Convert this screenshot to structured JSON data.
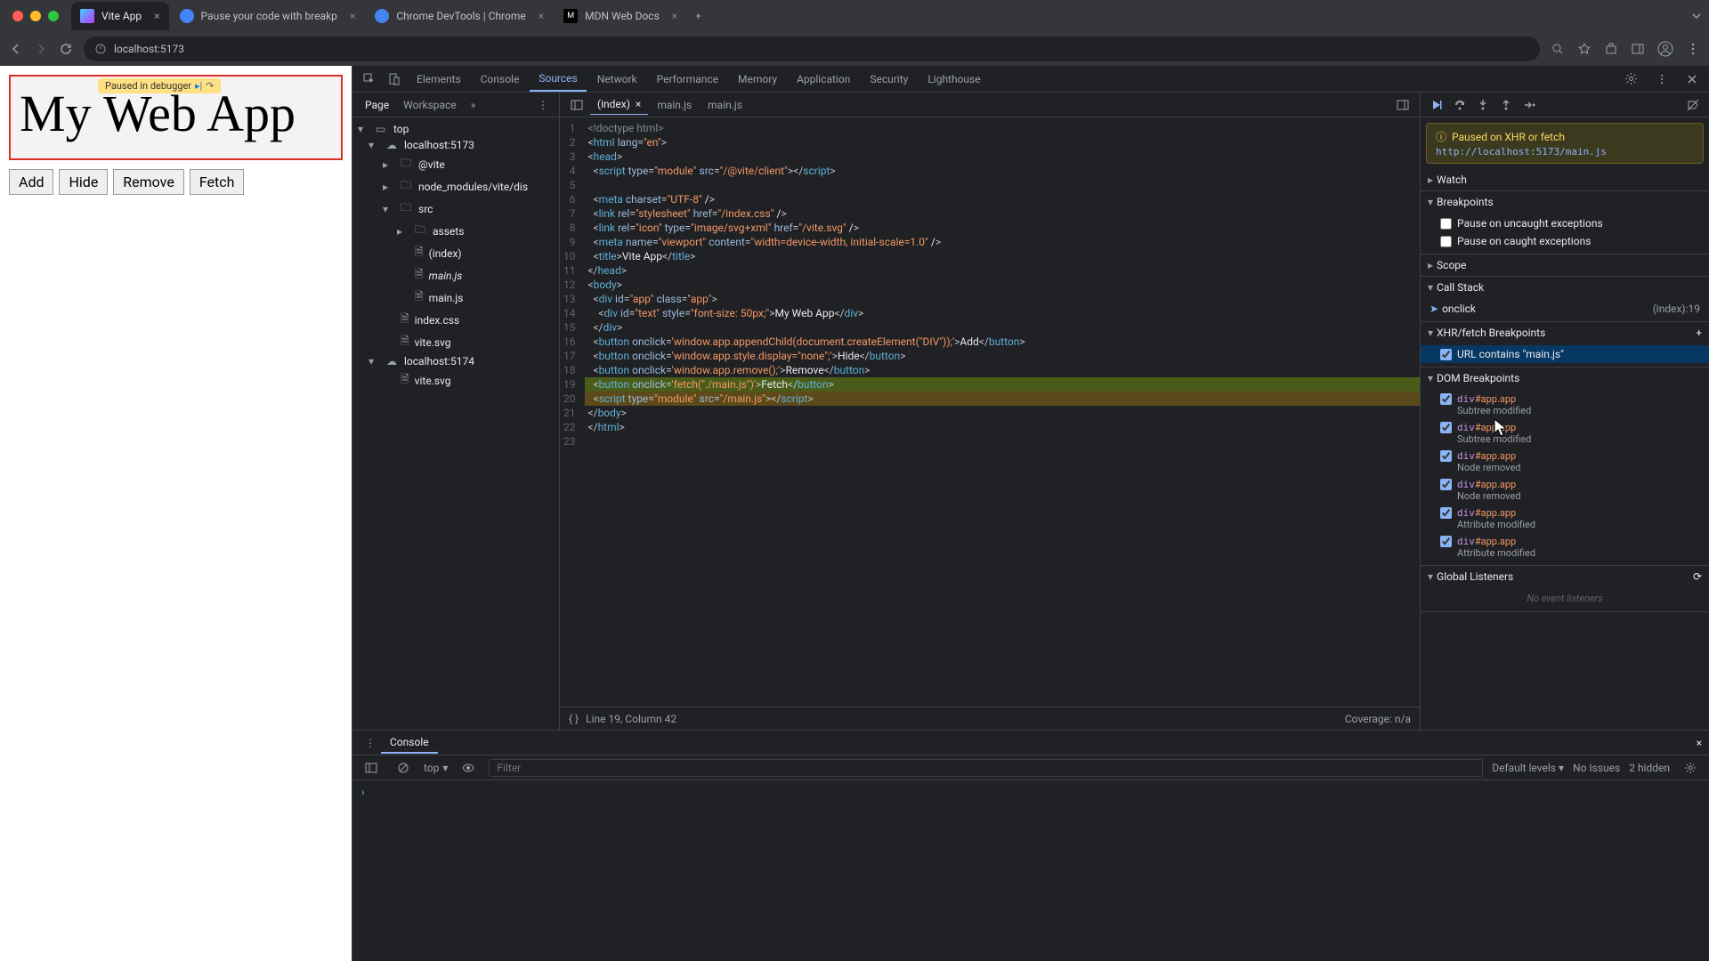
{
  "browser": {
    "tabs": [
      {
        "title": "Vite App",
        "active": true
      },
      {
        "title": "Pause your code with breakp",
        "active": false
      },
      {
        "title": "Chrome DevTools | Chrome",
        "active": false
      },
      {
        "title": "MDN Web Docs",
        "active": false
      }
    ],
    "url": "localhost:5173"
  },
  "preview": {
    "paused_label": "Paused in debugger",
    "title": "My Web App",
    "buttons": [
      "Add",
      "Hide",
      "Remove",
      "Fetch"
    ]
  },
  "devtools": {
    "panels": [
      "Elements",
      "Console",
      "Sources",
      "Network",
      "Performance",
      "Memory",
      "Application",
      "Security",
      "Lighthouse"
    ],
    "active_panel": "Sources",
    "sidebar_tabs": [
      "Page",
      "Workspace"
    ],
    "file_tree": {
      "top": "top",
      "host1": "localhost:5173",
      "vite": "@vite",
      "node_modules": "node_modules/vite/dis",
      "src": "src",
      "assets": "assets",
      "index": "(index)",
      "mainjs_italic": "main.js",
      "mainjs": "main.js",
      "indexcss": "index.css",
      "vitesvg": "vite.svg",
      "host2": "localhost:5174",
      "vitesvg2": "vite.svg"
    },
    "editor_tabs": [
      {
        "name": "(index)",
        "active": true
      },
      {
        "name": "main.js",
        "active": false
      },
      {
        "name": "main.js",
        "active": false
      }
    ],
    "code_lines": [
      "<!doctype html>",
      "<html lang=\"en\">",
      "<head>",
      "  <script type=\"module\" src=\"/@vite/client\"></scr_ipt>",
      "",
      "  <meta charset=\"UTF-8\" />",
      "  <link rel=\"stylesheet\" href=\"/index.css\" />",
      "  <link rel=\"icon\" type=\"image/svg+xml\" href=\"/vite.svg\" />",
      "  <meta name=\"viewport\" content=\"width=device-width, initial-scale=1.0\" />",
      "  <title>Vite App</title>",
      "</head>",
      "<body>",
      "  <div id=\"app\" class=\"app\">",
      "    <div id=\"text\" style=\"font-size: 50px;\">My Web App</div>",
      "  </div>",
      "  <button onclick='window.app.appendChild(document.createElement(\"DIV\"));'>Add</button>",
      "  <button onclick='window.app.style.display=\"none\";'>Hide</button>",
      "  <button onclick='window.app.remove();'>Remove</button>",
      "  <button onclick='fetch(\"./main.js\")'>Fetch</button>",
      "  <script type=\"module\" src=\"/main.js\"></scr_ipt>",
      "</body>",
      "</html>",
      ""
    ],
    "status": {
      "line": "Line 19, Column 42",
      "coverage": "Coverage: n/a"
    }
  },
  "debugger": {
    "pause_banner": {
      "title": "Paused on XHR or fetch",
      "url": "http://localhost:5173/main.js"
    },
    "sections": {
      "watch": "Watch",
      "breakpoints": "Breakpoints",
      "pause_uncaught": "Pause on uncaught exceptions",
      "pause_caught": "Pause on caught exceptions",
      "scope": "Scope",
      "call_stack": "Call Stack",
      "xhr": "XHR/fetch Breakpoints",
      "dom": "DOM Breakpoints",
      "global": "Global Listeners",
      "no_listeners": "No event listeners"
    },
    "call_stack": {
      "frame": "onclick",
      "loc": "(index):19"
    },
    "xhr_bp": "URL contains \"main.js\"",
    "dom_bps": [
      {
        "el": "div#app.app",
        "kind": "Subtree modified"
      },
      {
        "el": "div#app.app",
        "kind": "Subtree modified"
      },
      {
        "el": "div#app.app",
        "kind": "Node removed"
      },
      {
        "el": "div#app.app",
        "kind": "Node removed"
      },
      {
        "el": "div#app.app",
        "kind": "Attribute modified"
      },
      {
        "el": "div#app.app",
        "kind": "Attribute modified"
      }
    ]
  },
  "console": {
    "tab": "Console",
    "context": "top",
    "filter_placeholder": "Filter",
    "levels": "Default levels",
    "issues": "No Issues",
    "hidden": "2 hidden"
  }
}
